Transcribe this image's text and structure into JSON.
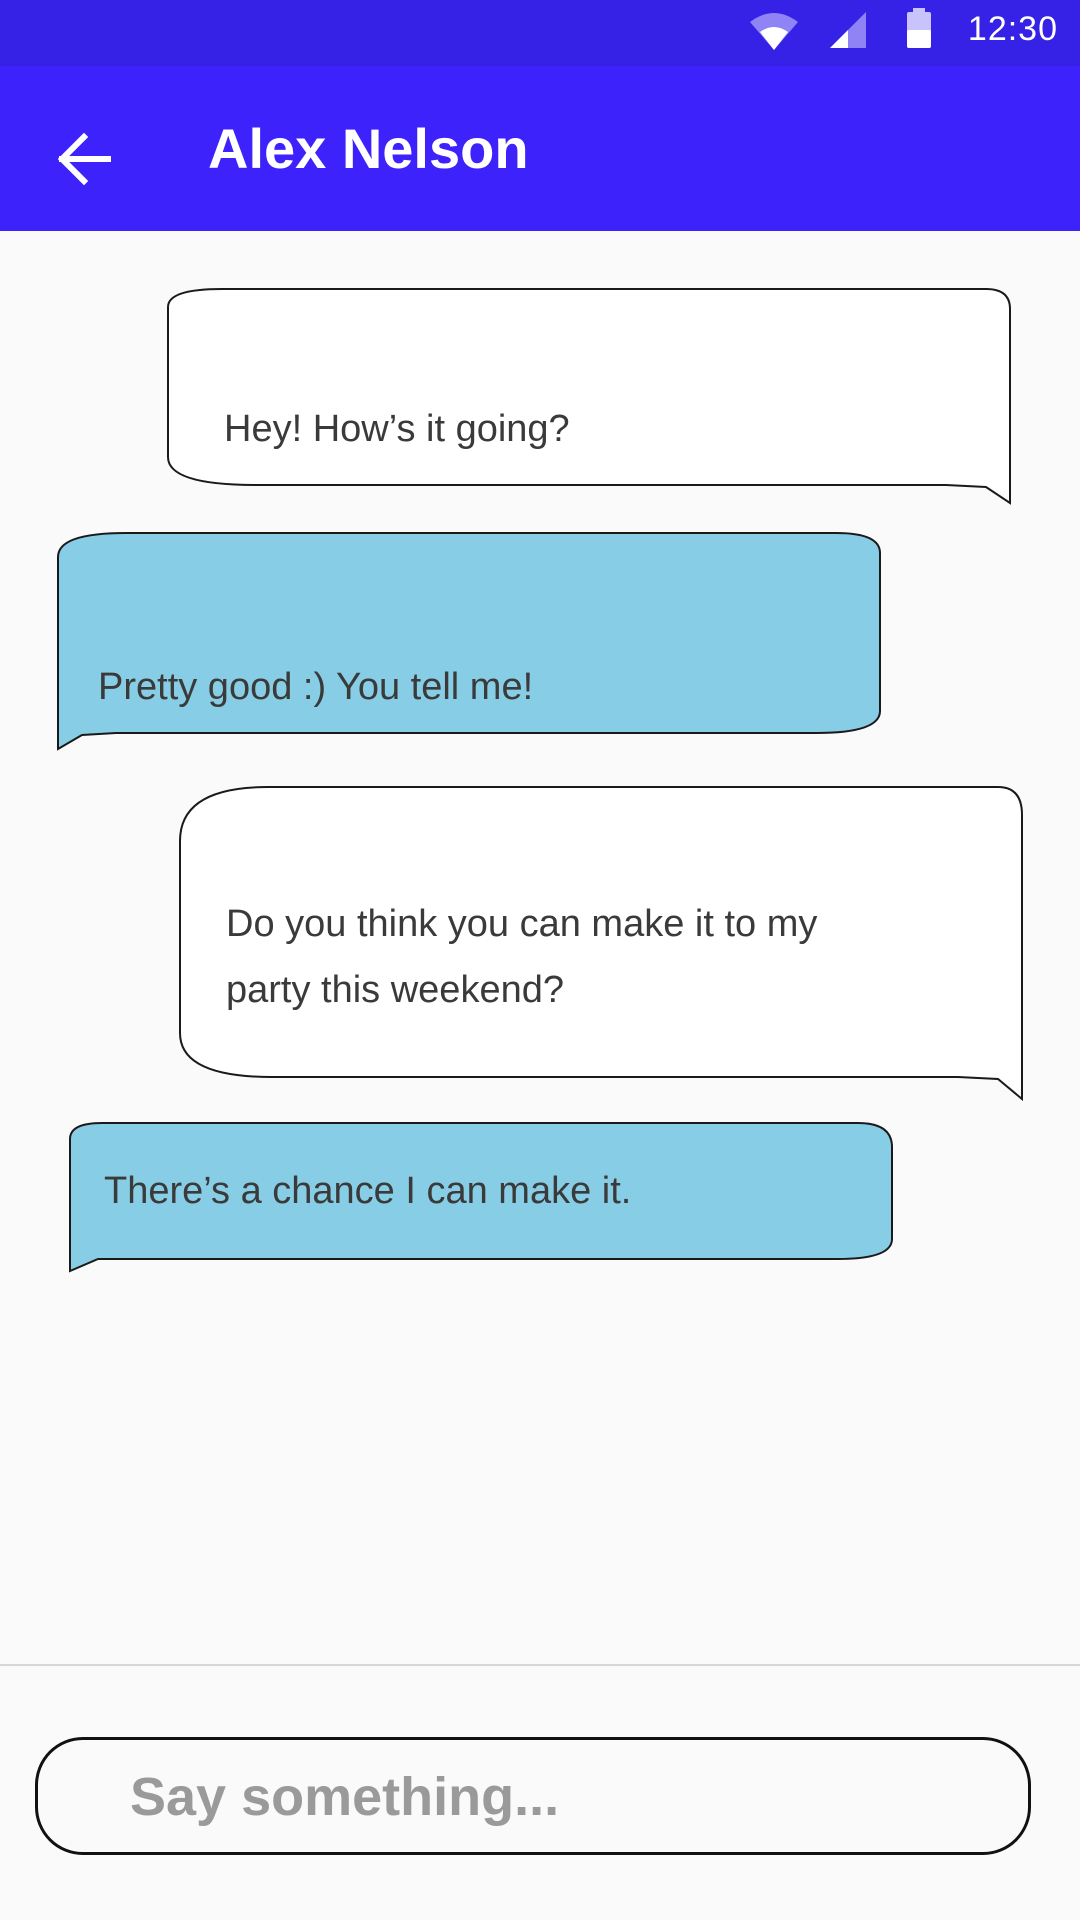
{
  "status_bar": {
    "time": "12:30",
    "icons": [
      "wifi-icon",
      "cell-signal-icon",
      "battery-icon"
    ]
  },
  "header": {
    "title": "Alex Nelson",
    "back_icon": "arrow-left-icon"
  },
  "messages": [
    {
      "sender": "contact",
      "lines": [
        "Hey! How’s it going?"
      ]
    },
    {
      "sender": "me",
      "lines": [
        "Pretty good :) You tell me!"
      ]
    },
    {
      "sender": "contact",
      "lines": [
        "Do you think you can make it to my",
        "party this weekend?"
      ]
    },
    {
      "sender": "me",
      "lines": [
        "There’s a chance I can make it."
      ]
    }
  ],
  "composer": {
    "placeholder": "Say something..."
  },
  "colors": {
    "status_bar": "#3621e6",
    "app_bar": "#3d22fc",
    "incoming_bubble": "#ffffff",
    "outgoing_bubble": "#87cde6",
    "bubble_border": "#1a1a1a",
    "background": "#fafafa"
  }
}
